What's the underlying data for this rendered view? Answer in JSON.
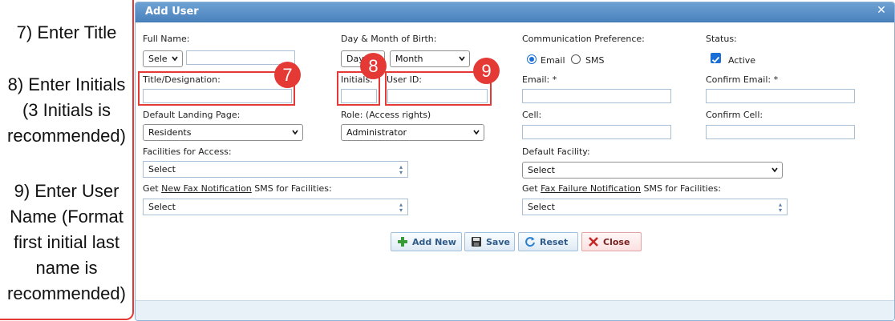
{
  "annotations": {
    "step7": "7) Enter Title",
    "step8_lines": [
      "8) Enter Initials",
      "(3 Initials is",
      "recommended)"
    ],
    "step9_lines": [
      "9) Enter User",
      "Name (Format",
      "first initial last",
      "name is",
      "recommended)"
    ],
    "badges": [
      "7",
      "8",
      "9"
    ]
  },
  "dialog": {
    "title": "Add User",
    "fields": {
      "full_name_label": "Full Name:",
      "full_name_prefix": "Sele",
      "dob_label": "Day & Month of Birth:",
      "dob_day": "Day",
      "dob_month": "Month",
      "comm_pref_label": "Communication Preference:",
      "comm_email": "Email",
      "comm_sms": "SMS",
      "status_label": "Status:",
      "status_active": "Active",
      "title_label": "Title/Designation:",
      "initials_label": "Initials:",
      "user_id_label": "User ID:",
      "email_label": "Email: *",
      "confirm_email_label": "Confirm Email: *",
      "landing_label": "Default Landing Page:",
      "landing_value": "Residents",
      "role_label": "Role: (Access rights)",
      "role_value": "Administrator",
      "cell_label": "Cell:",
      "confirm_cell_label": "Confirm Cell:",
      "facilities_label": "Facilities for Access:",
      "facilities_value": "Select",
      "default_facility_label": "Default Facility:",
      "default_facility_value": "Select",
      "fax_notif_prefix": "Get ",
      "fax_notif_link": "New Fax Notification",
      "fax_notif_suffix": " SMS for Facilities:",
      "fax_notif_value": "Select",
      "fax_fail_prefix": "Get ",
      "fax_fail_link": "Fax Failure Notification",
      "fax_fail_suffix": " SMS for Facilities:",
      "fax_fail_value": "Select"
    },
    "buttons": {
      "add_new": "Add New",
      "save": "Save",
      "reset": "Reset",
      "close": "Close"
    }
  },
  "colors": {
    "highlight": "#e53935",
    "titlebar": "#4a82bd",
    "accent": "#1a6fd6"
  }
}
